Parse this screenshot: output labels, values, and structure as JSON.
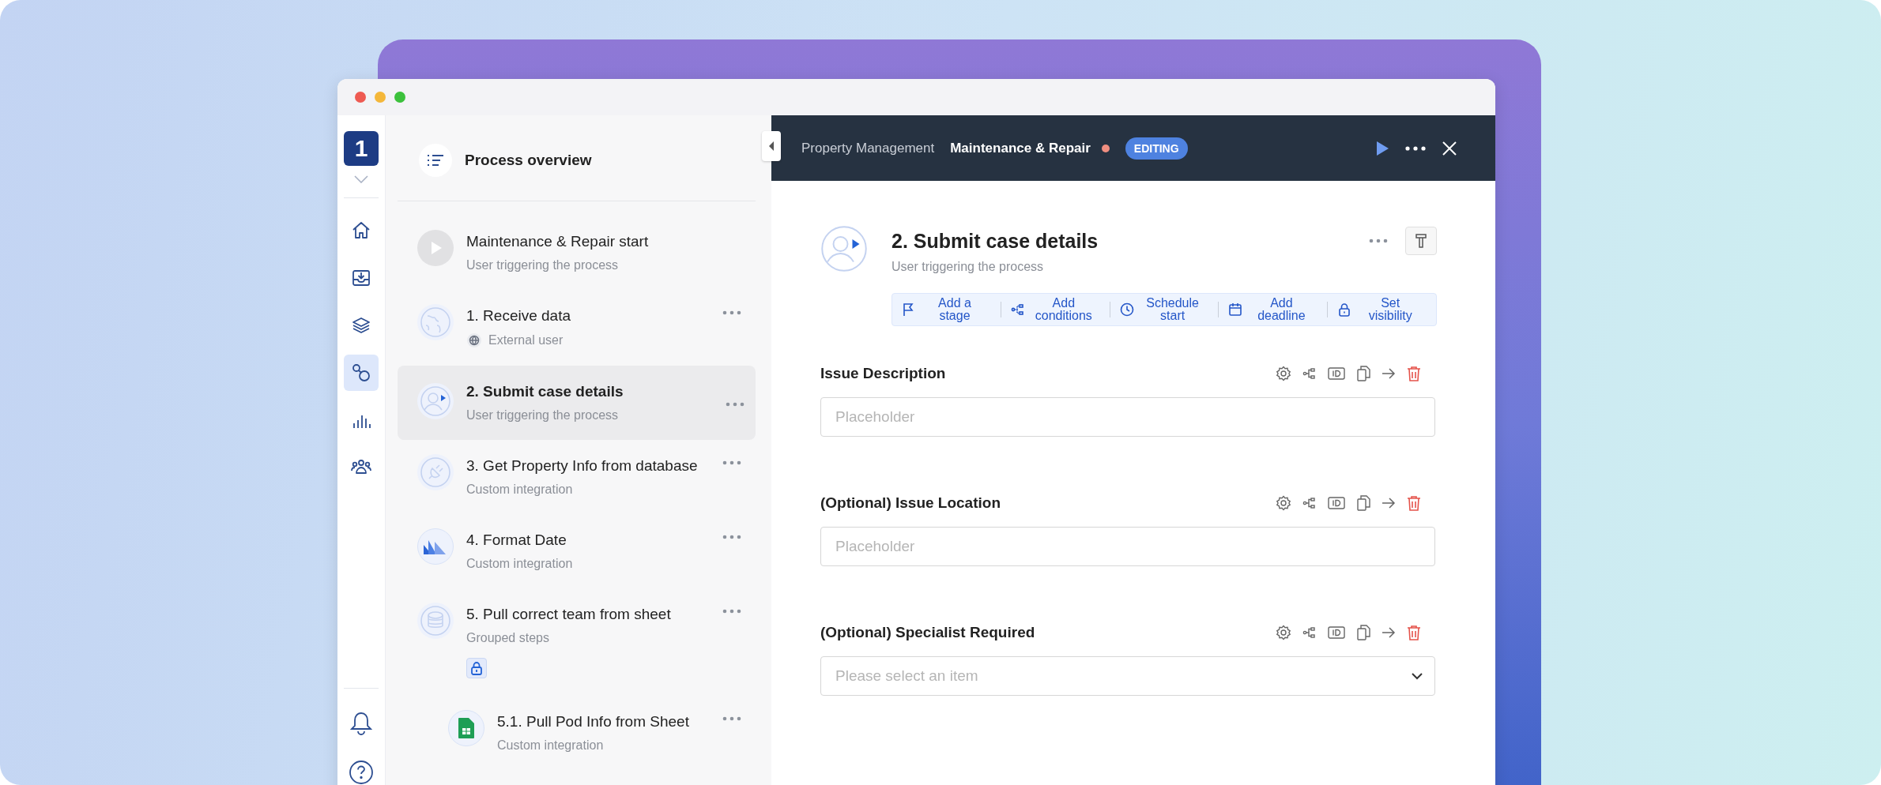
{
  "rail": {
    "badge": "1",
    "items": [
      {
        "kind": "home",
        "selected": false
      },
      {
        "kind": "inbox",
        "selected": false
      },
      {
        "kind": "layers",
        "selected": false
      },
      {
        "kind": "flow",
        "selected": true
      },
      {
        "kind": "chart",
        "selected": false
      },
      {
        "kind": "team",
        "selected": false
      }
    ]
  },
  "overview": {
    "title": "Process overview"
  },
  "steps": [
    {
      "kind": "start",
      "title": "Maintenance & Repair start",
      "subtitle": "User triggering the process",
      "selected": false,
      "menu": false
    },
    {
      "kind": "globe",
      "title": "1. Receive data",
      "subtitle": "External user",
      "selected": false,
      "menu": true
    },
    {
      "kind": "user",
      "title": "2. Submit case details",
      "subtitle": "User triggering the process",
      "selected": true,
      "menu": true
    },
    {
      "kind": "plug",
      "title": "3. Get Property Info from database",
      "subtitle": "Custom integration",
      "selected": false,
      "menu": true
    },
    {
      "kind": "chart",
      "title": "4. Format Date",
      "subtitle": "Custom integration",
      "selected": false,
      "menu": true
    },
    {
      "kind": "stack",
      "title": "5. Pull correct team from sheet",
      "subtitle": "Grouped steps",
      "selected": false,
      "menu": true,
      "locked": true,
      "children": [
        {
          "kind": "sheet",
          "title": "5.1. Pull Pod Info from Sheet",
          "subtitle": "Custom integration",
          "selected": false,
          "menu": true
        }
      ]
    }
  ],
  "header": {
    "breadcrumb": "Property Management",
    "title": "Maintenance & Repair",
    "unsaved": true,
    "status": "EDITING"
  },
  "step": {
    "title": "2. Submit case details",
    "subtitle": "User triggering the process",
    "actions": [
      {
        "kind": "flag",
        "label": "Add a stage"
      },
      {
        "kind": "branch",
        "label": "Add conditions"
      },
      {
        "kind": "clock",
        "label": "Schedule start"
      },
      {
        "kind": "calendar",
        "label": "Add deadline"
      },
      {
        "kind": "lock",
        "label": "Set visibility"
      }
    ]
  },
  "fields": [
    {
      "kind": "text",
      "label": "Issue Description",
      "placeholder": "Placeholder"
    },
    {
      "kind": "text",
      "label": "(Optional) Issue Location",
      "placeholder": "Placeholder"
    },
    {
      "kind": "select",
      "label": "(Optional) Specialist Required",
      "placeholder": "Please select an item"
    }
  ]
}
